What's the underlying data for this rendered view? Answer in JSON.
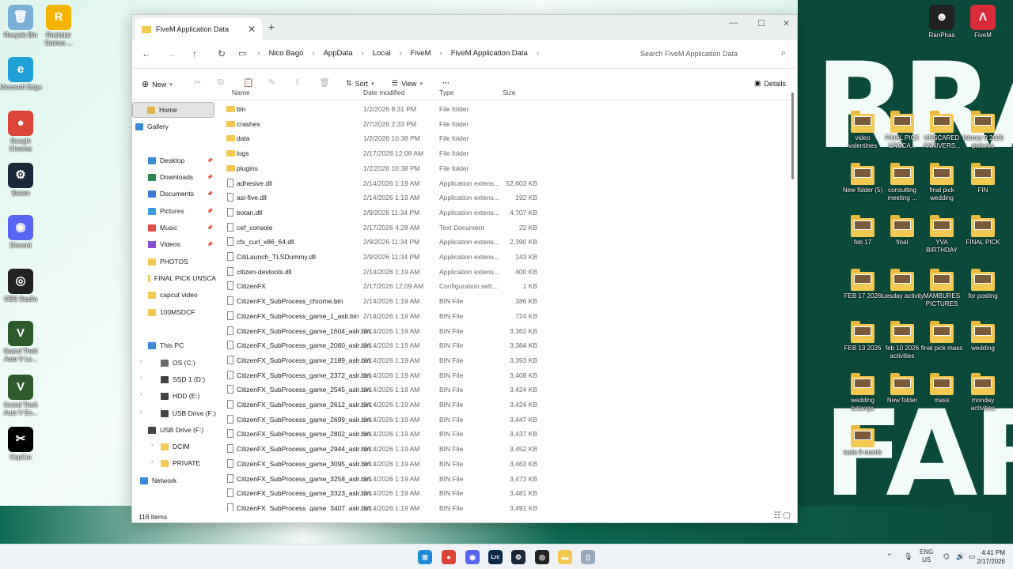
{
  "desktop_left": [
    {
      "label": "Recycle Bin",
      "icon": "recycle-bin-icon",
      "color": "#7ab0d8",
      "glyph": "🗑"
    },
    {
      "label": "Rockstar Games ...",
      "icon": "rockstar-icon",
      "color": "#f4b400",
      "glyph": "R"
    },
    {
      "label": "Microsoft Edge",
      "icon": "edge-icon",
      "color": "#1fa0d8",
      "glyph": "e"
    },
    {
      "label": "Google Chrome",
      "icon": "chrome-icon",
      "color": "#db4437",
      "glyph": "●"
    },
    {
      "label": "Steam",
      "icon": "steam-icon",
      "color": "#1b2838",
      "glyph": "⚙"
    },
    {
      "label": "Discord",
      "icon": "discord-icon",
      "color": "#5865f2",
      "glyph": "◉"
    },
    {
      "label": "OBS Studio",
      "icon": "obs-icon",
      "color": "#222",
      "glyph": "◎"
    },
    {
      "label": "Grand Theft Auto V Le...",
      "icon": "gta-icon",
      "color": "#2e5a2e",
      "glyph": "V"
    },
    {
      "label": "Grand Theft Auto V En...",
      "icon": "gta-icon",
      "color": "#2e5a2e",
      "glyph": "V"
    },
    {
      "label": "CapCut",
      "icon": "capcut-icon",
      "color": "#000",
      "glyph": "✂"
    }
  ],
  "desktop_right_top": [
    {
      "label": "RanPhas",
      "icon": "app-icon",
      "color": "#222",
      "glyph": "☻"
    },
    {
      "label": "FiveM",
      "icon": "fivem-icon",
      "color": "#d92b3a",
      "glyph": "Λ"
    }
  ],
  "desktop_right": [
    {
      "label": "video valentines"
    },
    {
      "label": "FINAL PICK UNSCA..."
    },
    {
      "label": "UNSCARED ANNIVERS..."
    },
    {
      "label": "febrary 9 2026 pictures"
    },
    {
      "label": "New folder (5)"
    },
    {
      "label": "consulting meeting ..."
    },
    {
      "label": "final pick wedding"
    },
    {
      "label": "FIN"
    },
    {
      "label": "feb 17"
    },
    {
      "label": "final"
    },
    {
      "label": "YVA BIRTHDAY"
    },
    {
      "label": "FINAL PICK"
    },
    {
      "label": "FEB 17 2026"
    },
    {
      "label": "tuesday activity"
    },
    {
      "label": "MAMBURES PICTURES"
    },
    {
      "label": "for posting"
    },
    {
      "label": "FEB 13 2026"
    },
    {
      "label": "feb 10 2026 activities"
    },
    {
      "label": "final pick mass"
    },
    {
      "label": "wedding"
    },
    {
      "label": "wedding balanga"
    },
    {
      "label": "New folder"
    },
    {
      "label": "mass"
    },
    {
      "label": "monday activities"
    },
    {
      "label": "tasia 9 month"
    }
  ],
  "window": {
    "tab_title": "FiveM Application Data",
    "new_tab": "+",
    "breadcrumbs": [
      "Nico Bago",
      "AppData",
      "Local",
      "FiveM",
      "FiveM Application Data"
    ],
    "search_placeholder": "Search FiveM Application Data",
    "toolbar": {
      "new": "New",
      "sort": "Sort",
      "view": "View",
      "more": "···",
      "details": "Details"
    },
    "nav": [
      {
        "label": "Home",
        "selected": true,
        "color": "#e0b64a"
      },
      {
        "label": "Gallery",
        "color": "#3b8ad9"
      },
      {
        "label": "Desktop",
        "pinned": true,
        "color": "#3b8ad9"
      },
      {
        "label": "Downloads",
        "pinned": true,
        "color": "#2d8a4e"
      },
      {
        "label": "Documents",
        "pinned": true,
        "color": "#3b7bd9"
      },
      {
        "label": "Pictures",
        "pinned": true,
        "color": "#3b9ad9"
      },
      {
        "label": "Music",
        "pinned": true,
        "color": "#e0524a"
      },
      {
        "label": "Videos",
        "pinned": true,
        "color": "#8a4ad9"
      },
      {
        "label": "PHOTOS",
        "color": "#f3c951"
      },
      {
        "label": "FINAL PICK UNSCA",
        "color": "#f3c951"
      },
      {
        "label": "capcut video",
        "color": "#f3c951"
      },
      {
        "label": "100MSDCF",
        "color": "#f3c951"
      },
      {
        "label": "This PC",
        "color": "#3b8ad9"
      },
      {
        "label": "OS (C:)",
        "color": "#6b6b6b"
      },
      {
        "label": "SSD 1 (D:)",
        "color": "#444"
      },
      {
        "label": "HDD (E:)",
        "color": "#444"
      },
      {
        "label": "USB Drive (F:)",
        "color": "#444"
      },
      {
        "label": "USB Drive (F:)",
        "color": "#444"
      },
      {
        "label": "DCIM",
        "color": "#f3c951"
      },
      {
        "label": "PRIVATE",
        "color": "#f3c951"
      },
      {
        "label": "Network",
        "color": "#3b8ad9"
      }
    ],
    "columns": {
      "name": "Name",
      "date": "Date modified",
      "type": "Type",
      "size": "Size"
    },
    "files": [
      {
        "name": "bin",
        "date": "1/2/2026 8:31 PM",
        "type": "File folder",
        "size": "",
        "kind": "folder"
      },
      {
        "name": "crashes",
        "date": "2/7/2026 2:33 PM",
        "type": "File folder",
        "size": "",
        "kind": "folder"
      },
      {
        "name": "data",
        "date": "1/2/2026 10:38 PM",
        "type": "File folder",
        "size": "",
        "kind": "folder"
      },
      {
        "name": "logs",
        "date": "2/17/2026 12:08 AM",
        "type": "File folder",
        "size": "",
        "kind": "folder"
      },
      {
        "name": "plugins",
        "date": "1/2/2026 10:38 PM",
        "type": "File folder",
        "size": "",
        "kind": "folder"
      },
      {
        "name": "adhesive.dll",
        "date": "2/14/2026 1:19 AM",
        "type": "Application extens...",
        "size": "52,603 KB",
        "kind": "file"
      },
      {
        "name": "asi-five.dll",
        "date": "2/14/2026 1:19 AM",
        "type": "Application extens...",
        "size": "192 KB",
        "kind": "file"
      },
      {
        "name": "botan.dll",
        "date": "2/9/2026 11:34 PM",
        "type": "Application extens...",
        "size": "4,707 KB",
        "kind": "file"
      },
      {
        "name": "cef_console",
        "date": "2/17/2026 4:28 AM",
        "type": "Text Document",
        "size": "22 KB",
        "kind": "file"
      },
      {
        "name": "cfx_curl_x86_64.dll",
        "date": "2/9/2026 11:34 PM",
        "type": "Application extens...",
        "size": "2,390 KB",
        "kind": "file"
      },
      {
        "name": "CitiLaunch_TLSDummy.dll",
        "date": "2/9/2026 11:34 PM",
        "type": "Application extens...",
        "size": "143 KB",
        "kind": "file"
      },
      {
        "name": "citizen-devtools.dll",
        "date": "2/14/2026 1:19 AM",
        "type": "Application extens...",
        "size": "400 KB",
        "kind": "file"
      },
      {
        "name": "CitizenFX",
        "date": "2/17/2026 12:09 AM",
        "type": "Configuration sett...",
        "size": "1 KB",
        "kind": "file"
      },
      {
        "name": "CitizenFX_SubProcess_chrome.bin",
        "date": "2/14/2026 1:19 AM",
        "type": "BIN File",
        "size": "386 KB",
        "kind": "file"
      },
      {
        "name": "CitizenFX_SubProcess_game_1_aslr.bin",
        "date": "2/14/2026 1:19 AM",
        "type": "BIN File",
        "size": "724 KB",
        "kind": "file"
      },
      {
        "name": "CitizenFX_SubProcess_game_1604_aslr.bin",
        "date": "2/14/2026 1:19 AM",
        "type": "BIN File",
        "size": "3,362 KB",
        "kind": "file"
      },
      {
        "name": "CitizenFX_SubProcess_game_2060_aslr.bin",
        "date": "2/14/2026 1:19 AM",
        "type": "BIN File",
        "size": "3,384 KB",
        "kind": "file"
      },
      {
        "name": "CitizenFX_SubProcess_game_2189_aslr.bin",
        "date": "2/14/2026 1:19 AM",
        "type": "BIN File",
        "size": "3,393 KB",
        "kind": "file"
      },
      {
        "name": "CitizenFX_SubProcess_game_2372_aslr.bin",
        "date": "2/14/2026 1:19 AM",
        "type": "BIN File",
        "size": "3,408 KB",
        "kind": "file"
      },
      {
        "name": "CitizenFX_SubProcess_game_2545_aslr.bin",
        "date": "2/14/2026 1:19 AM",
        "type": "BIN File",
        "size": "3,424 KB",
        "kind": "file"
      },
      {
        "name": "CitizenFX_SubProcess_game_2612_aslr.bin",
        "date": "2/14/2026 1:19 AM",
        "type": "BIN File",
        "size": "3,424 KB",
        "kind": "file"
      },
      {
        "name": "CitizenFX_SubProcess_game_2699_aslr.bin",
        "date": "2/14/2026 1:19 AM",
        "type": "BIN File",
        "size": "3,447 KB",
        "kind": "file"
      },
      {
        "name": "CitizenFX_SubProcess_game_2802_aslr.bin",
        "date": "2/14/2026 1:19 AM",
        "type": "BIN File",
        "size": "3,437 KB",
        "kind": "file"
      },
      {
        "name": "CitizenFX_SubProcess_game_2944_aslr.bin",
        "date": "2/14/2026 1:19 AM",
        "type": "BIN File",
        "size": "3,452 KB",
        "kind": "file"
      },
      {
        "name": "CitizenFX_SubProcess_game_3095_aslr.bin",
        "date": "2/14/2026 1:19 AM",
        "type": "BIN File",
        "size": "3,463 KB",
        "kind": "file"
      },
      {
        "name": "CitizenFX_SubProcess_game_3258_aslr.bin",
        "date": "2/14/2026 1:19 AM",
        "type": "BIN File",
        "size": "3,473 KB",
        "kind": "file"
      },
      {
        "name": "CitizenFX_SubProcess_game_3323_aslr.bin",
        "date": "2/14/2026 1:19 AM",
        "type": "BIN File",
        "size": "3,481 KB",
        "kind": "file"
      },
      {
        "name": "CitizenFX_SubProcess_game_3407_aslr.bin",
        "date": "2/14/2026 1:19 AM",
        "type": "BIN File",
        "size": "3,491 KB",
        "kind": "file"
      }
    ],
    "status": "116 items"
  },
  "taskbar": {
    "apps": [
      {
        "name": "start-icon",
        "color": "#1f8ad9",
        "glyph": "⊞"
      },
      {
        "name": "chrome-icon",
        "color": "#db4437",
        "glyph": "●"
      },
      {
        "name": "discord-icon",
        "color": "#5865f2",
        "glyph": "◉"
      },
      {
        "name": "lightroom-icon",
        "color": "#0b2a4a",
        "glyph": "Lrc"
      },
      {
        "name": "steam-icon",
        "color": "#1b2838",
        "glyph": "⚙"
      },
      {
        "name": "obs-icon",
        "color": "#222",
        "glyph": "◎"
      },
      {
        "name": "file-explorer-icon",
        "color": "#f3c951",
        "glyph": "▬"
      },
      {
        "name": "notepad-icon",
        "color": "#9ab",
        "glyph": "▯"
      }
    ],
    "lang": "ENG",
    "region": "US",
    "time": "4:41 PM",
    "date": "2/17/2026"
  },
  "wallpaper_text": [
    "RRA",
    "FAR",
    "FAR"
  ]
}
